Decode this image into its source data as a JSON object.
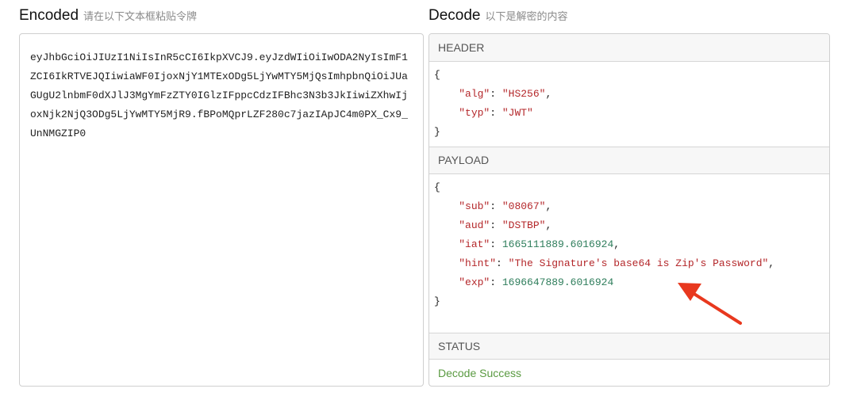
{
  "encoded": {
    "title": "Encoded",
    "subtitle": "请在以下文本框粘贴令牌",
    "token": "eyJhbGciOiJIUzI1NiIsInR5cCI6IkpXVCJ9.eyJzdWIiOiIwODA2NyIsImF1ZCI6IkRTVEJQIiwiaWF0IjoxNjY1MTExODg5LjYwMTY5MjQsImhpbnQiOiJUaGUgU2lnbmF0dXJlJ3MgYmFzZTY0IGlzIFppcCdzIFBhc3N3b3JkIiwiZXhwIjoxNjk2NjQ3ODg5LjYwMTY5MjR9.fBPoMQprLZF280c7jazIApJC4m0PX_Cx9_UnNMGZIP0"
  },
  "decode": {
    "title": "Decode",
    "subtitle": "以下是解密的内容",
    "header_label": "HEADER",
    "payload_label": "PAYLOAD",
    "status_label": "STATUS",
    "status_value": "Decode Success",
    "brace_open": "{",
    "brace_close": "}",
    "header_fields": {
      "alg_key": "\"alg\"",
      "alg_val": "\"HS256\"",
      "typ_key": "\"typ\"",
      "typ_val": "\"JWT\""
    },
    "payload_fields": {
      "sub_key": "\"sub\"",
      "sub_val": "\"08067\"",
      "aud_key": "\"aud\"",
      "aud_val": "\"DSTBP\"",
      "iat_key": "\"iat\"",
      "iat_val": "1665111889.6016924",
      "hint_key": "\"hint\"",
      "hint_val": "\"The Signature's base64 is Zip's Password\"",
      "exp_key": "\"exp\"",
      "exp_val": "1696647889.6016924"
    }
  },
  "colors": {
    "json_string": "#b4272a",
    "json_number": "#2e7d5b",
    "success": "#5a9a41",
    "annotation_arrow": "#e8381e"
  }
}
